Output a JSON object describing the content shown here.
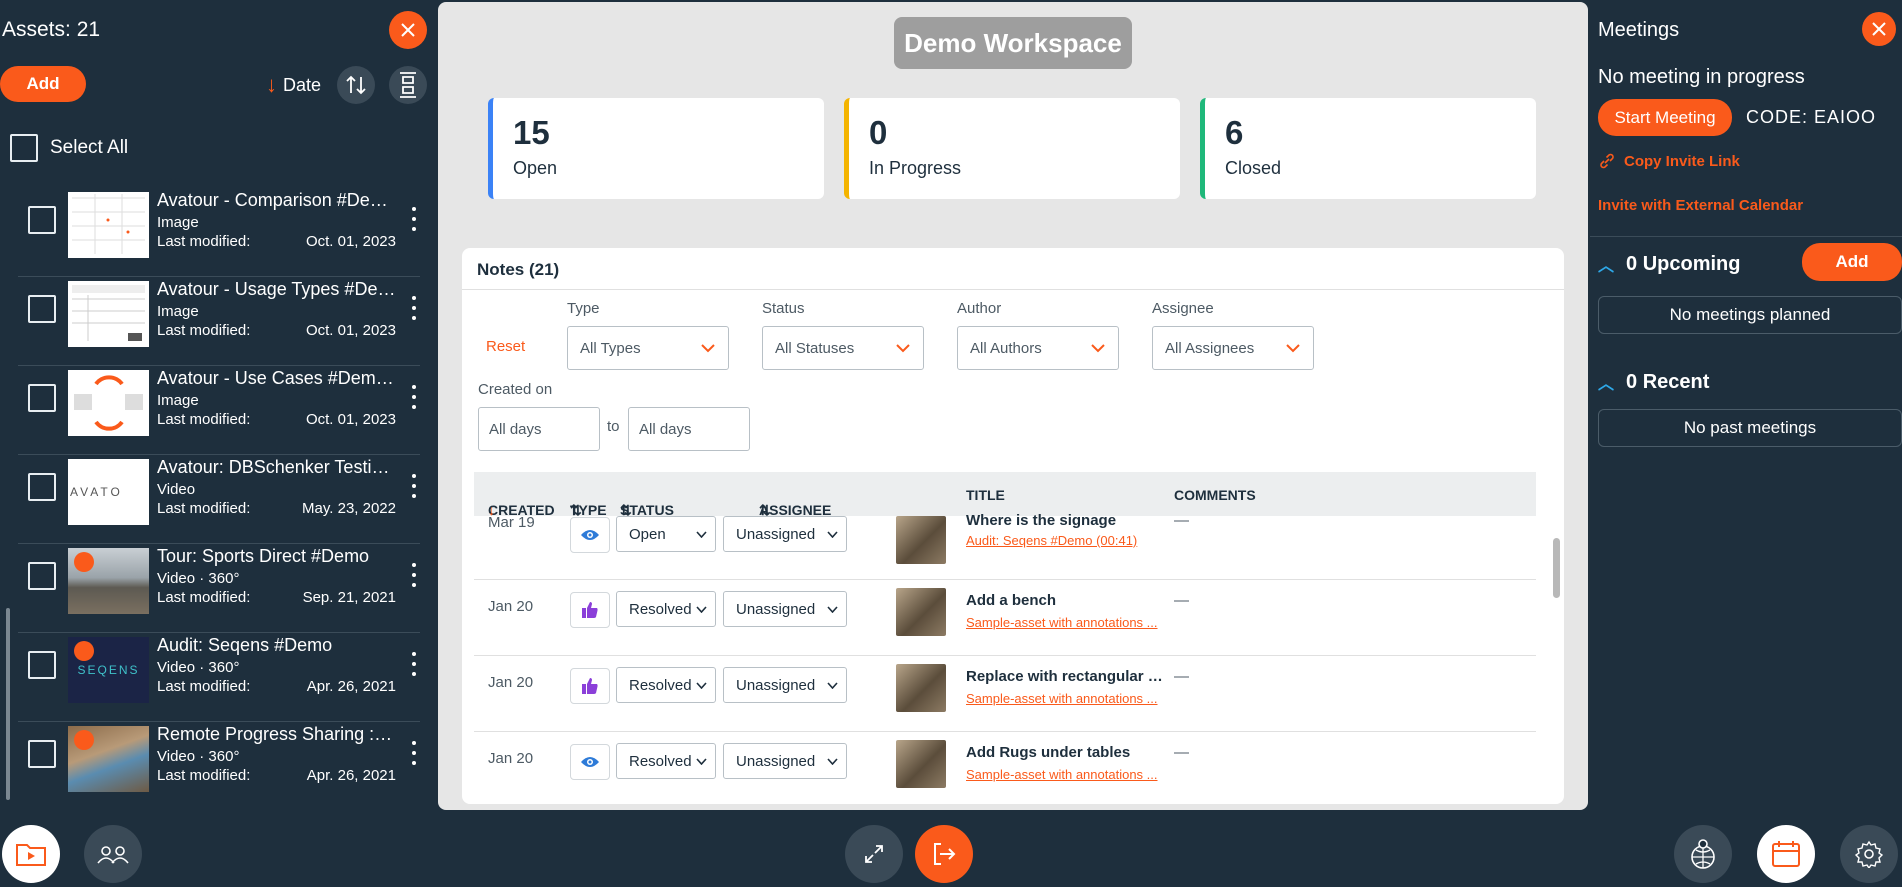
{
  "left": {
    "title": "Assets: 21",
    "add_label": "Add",
    "sort_label": "Date",
    "select_all_label": "Select All",
    "assets": [
      {
        "name": "Avatour - Comparison #Dem...",
        "kind": "Image",
        "modified_label": "Last modified:",
        "date": "Oct. 01, 2023"
      },
      {
        "name": "Avatour - Usage Types #Dem...",
        "kind": "Image",
        "modified_label": "Last modified:",
        "date": "Oct. 01, 2023"
      },
      {
        "name": "Avatour - Use Cases #Demo....",
        "kind": "Image",
        "modified_label": "Last modified:",
        "date": "Oct. 01, 2023"
      },
      {
        "name": "Avatour: DBSchenker Testim...",
        "kind": "Video",
        "modified_label": "Last modified:",
        "date": "May. 23, 2022"
      },
      {
        "name": "Tour: Sports Direct #Demo",
        "kind": "Video · 360°",
        "modified_label": "Last modified:",
        "date": "Sep. 21, 2021"
      },
      {
        "name": "Audit: Seqens #Demo",
        "kind": "Video · 360°",
        "modified_label": "Last modified:",
        "date": "Apr. 26, 2021"
      },
      {
        "name": "Remote Progress Sharing : C...",
        "kind": "Video · 360°",
        "modified_label": "Last modified:",
        "date": "Apr. 26, 2021"
      }
    ],
    "thumb_texts": {
      "avatour": "AVATO",
      "seqens": "SEQENS"
    }
  },
  "center": {
    "workspace_title": "Demo Workspace",
    "stats": [
      {
        "value": "15",
        "label": "Open",
        "color": "#3b82f6"
      },
      {
        "value": "0",
        "label": "In Progress",
        "color": "#f4b400"
      },
      {
        "value": "6",
        "label": "Closed",
        "color": "#1fb87a"
      }
    ],
    "notes": {
      "header": "Notes (21)",
      "reset": "Reset",
      "filters": {
        "type_label": "Type",
        "type_value": "All Types",
        "status_label": "Status",
        "status_value": "All Statuses",
        "author_label": "Author",
        "author_value": "All Authors",
        "assignee_label": "Assignee",
        "assignee_value": "All Assignees",
        "created_label": "Created on",
        "from_value": "All days",
        "to_label": "to",
        "to_value": "All days"
      },
      "columns": {
        "created": "CREATED",
        "type": "TYPE",
        "status": "STATUS",
        "assignee": "ASSIGNEE",
        "title": "TITLE",
        "comments": "COMMENTS"
      },
      "rows": [
        {
          "created": "Mar 19",
          "type": "eye",
          "status": "Open",
          "assignee": "Unassigned",
          "title": "Where is the signage",
          "link": "Audit: Seqens #Demo (00:41)",
          "comments": "—"
        },
        {
          "created": "Jan 20",
          "type": "thumb",
          "status": "Resolved",
          "assignee": "Unassigned",
          "title": "Add a bench",
          "link": "Sample-asset with annotations ...",
          "comments": "—"
        },
        {
          "created": "Jan 20",
          "type": "thumb",
          "status": "Resolved",
          "assignee": "Unassigned",
          "title": "Replace with rectangular ta...",
          "link": "Sample-asset with annotations ...",
          "comments": "—"
        },
        {
          "created": "Jan 20",
          "type": "eye",
          "status": "Resolved",
          "assignee": "Unassigned",
          "title": "Add Rugs under tables",
          "link": "Sample-asset with annotations ...",
          "comments": "—"
        }
      ]
    }
  },
  "right": {
    "title": "Meetings",
    "status": "No meeting in progress",
    "start_label": "Start Meeting",
    "code": "CODE: EAIOO",
    "copy_invite": "Copy Invite Link",
    "invite_external": "Invite with External Calendar",
    "upcoming_label": "0 Upcoming",
    "upcoming_add": "Add",
    "upcoming_empty": "No meetings planned",
    "recent_label": "0 Recent",
    "recent_empty": "No past meetings"
  },
  "colors": {
    "accent": "#fa5a1b",
    "bg": "#1e2f3d",
    "panel": "#e6e6e6"
  }
}
